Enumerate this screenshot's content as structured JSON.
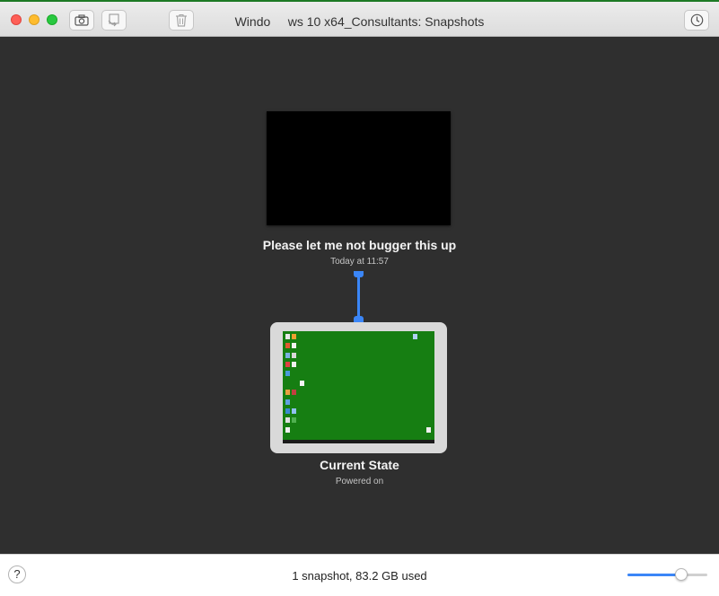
{
  "window": {
    "title": "Windo     ws 10 x64_Consultants: Snapshots",
    "buttons": {
      "take_snapshot_icon": "camera-icon",
      "restore_icon": "restore-snapshot-icon",
      "delete_icon": "trash-icon",
      "auto_snapshot_icon": "clock-icon"
    }
  },
  "snapshot": {
    "name": "Please let me not bugger this up",
    "date": "Today at 11:57"
  },
  "current": {
    "name": "Current State",
    "status": "Powered on"
  },
  "footer": {
    "help_label": "?",
    "usage": "1 snapshot, 83.2 GB used",
    "zoom_level": 0.67
  },
  "colors": {
    "accent": "#3b86f7",
    "desktop": "#167e12",
    "background": "#2f2f2f"
  }
}
